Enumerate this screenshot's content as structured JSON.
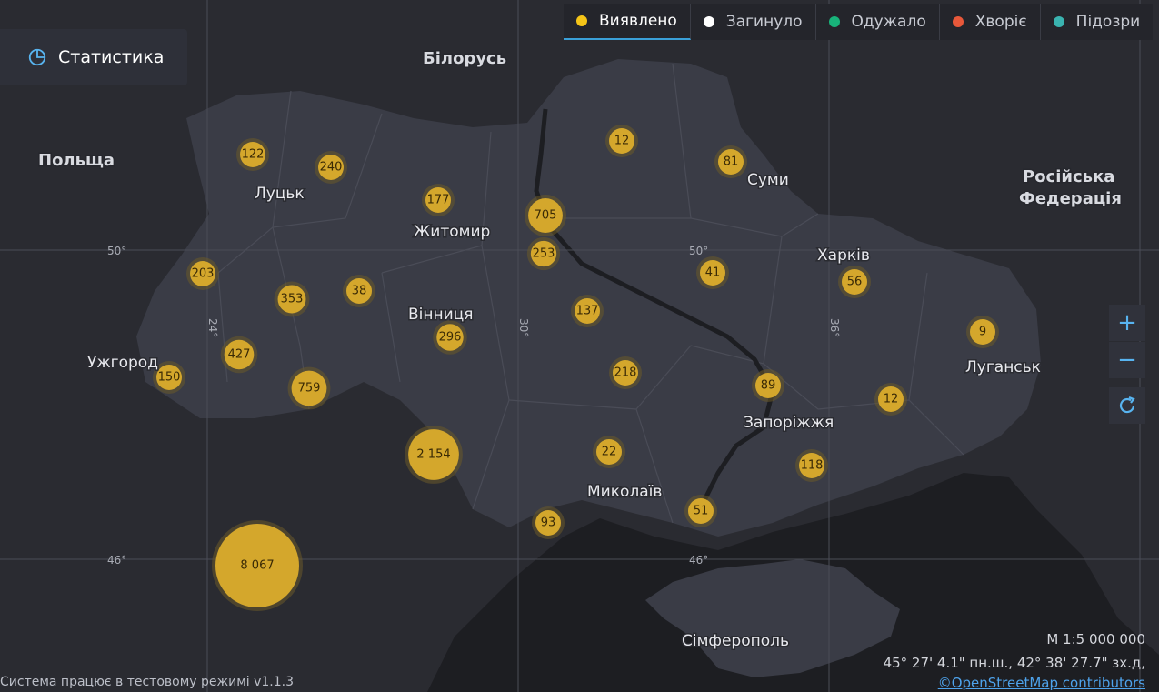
{
  "stats_button": {
    "label": "Статистика"
  },
  "tabs": [
    {
      "label": "Виявлено",
      "color": "#f5c518",
      "active": true
    },
    {
      "label": "Загинуло",
      "color": "#ffffff",
      "active": false
    },
    {
      "label": "Одужало",
      "color": "#18b37a",
      "active": false
    },
    {
      "label": "Хворіє",
      "color": "#e8583a",
      "active": false
    },
    {
      "label": "Підозри",
      "color": "#3ab3b0",
      "active": false
    }
  ],
  "countries": [
    "Білорусь",
    "Польща",
    "Російська",
    "Федерація"
  ],
  "cities": [
    "Луцьк",
    "Житомир",
    "Суми",
    "Харків",
    "Вінниця",
    "Ужгород",
    "Луганськ",
    "Запоріжжя",
    "Миколаїв",
    "Сімферополь"
  ],
  "grid_labels": [
    "50°",
    "50°",
    "24°",
    "30°",
    "36°",
    "46°",
    "46°"
  ],
  "clusters": [
    "122",
    "240",
    "177",
    "705",
    "12",
    "81",
    "253",
    "203",
    "353",
    "38",
    "41",
    "56",
    "137",
    "296",
    "9",
    "427",
    "150",
    "759",
    "218",
    "89",
    "12",
    "2 154",
    "22",
    "118",
    "51",
    "93",
    "8 067"
  ],
  "zoom": {
    "in": "+",
    "out": "−"
  },
  "scale": "М 1:5 000 000",
  "coordinates": "45° 27' 4.1\" пн.ш., 42° 38' 27.7\" зх.д,",
  "attribution": "©OpenStreetMap contributors",
  "test_notice": "Система працює в тестовому режимі v1.1.3"
}
